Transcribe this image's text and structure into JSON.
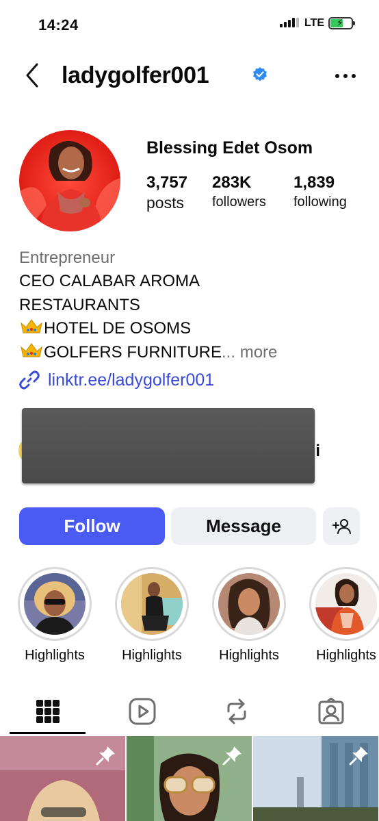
{
  "status_bar": {
    "time": "14:24",
    "network": "LTE",
    "battery_charging": true,
    "battery_color": "#34c759"
  },
  "header": {
    "username": "ladygolfer001",
    "verified": true,
    "back_icon": "chevron-left-icon",
    "more_icon": "ellipsis-icon"
  },
  "profile": {
    "display_name": "Blessing Edet Osom",
    "stats": [
      {
        "value": "3,757",
        "label": "posts"
      },
      {
        "value": "283K",
        "label": "followers"
      },
      {
        "value": "1,839",
        "label": "following"
      }
    ]
  },
  "bio": {
    "category": "Entrepreneur",
    "lines": [
      "CEO CALABAR AROMA",
      "RESTAURANTS",
      "HOTEL DE OSOMS",
      "GOLFERS FURNITURE"
    ],
    "ellipsis": "...",
    "more_label": "more",
    "link": "linktr.ee/ladygolfer001"
  },
  "mutual": {
    "partial_text": "oii"
  },
  "actions": {
    "follow_label": "Follow",
    "message_label": "Message",
    "suggest_icon": "add-person-icon",
    "follow_color": "#4a5bf4"
  },
  "highlights": [
    {
      "label": "Highlights"
    },
    {
      "label": "Highlights"
    },
    {
      "label": "Highlights"
    },
    {
      "label": "Highlights"
    }
  ],
  "tabs": [
    {
      "icon": "grid-icon",
      "active": true
    },
    {
      "icon": "reels-icon",
      "active": false
    },
    {
      "icon": "reposts-icon",
      "active": false
    },
    {
      "icon": "tagged-icon",
      "active": false
    }
  ],
  "grid_posts": [
    {
      "pinned": true
    },
    {
      "pinned": true
    },
    {
      "pinned": true
    }
  ]
}
